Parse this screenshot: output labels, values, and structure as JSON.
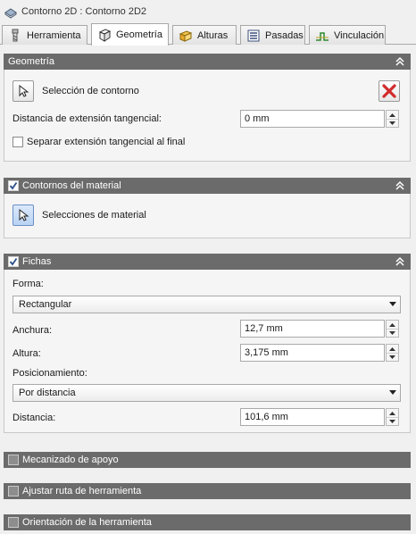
{
  "window": {
    "title": "Contorno 2D : Contorno 2D2"
  },
  "tabs": [
    {
      "label": "Herramienta",
      "icon": "tool-icon"
    },
    {
      "label": "Geometría",
      "icon": "cube-icon"
    },
    {
      "label": "Alturas",
      "icon": "heights-icon"
    },
    {
      "label": "Pasadas",
      "icon": "passes-icon"
    },
    {
      "label": "Vinculación",
      "icon": "linking-icon"
    }
  ],
  "active_tab": "Geometría",
  "geometria": {
    "title": "Geometría",
    "contour_button": "Selección de contorno",
    "tangential_label": "Distancia de extensión tangencial:",
    "tangential_value": "0 mm",
    "separate_label": "Separar extensión tangencial al final",
    "separate_checked": false
  },
  "material": {
    "title": "Contornos del material",
    "checked": true,
    "button": "Selecciones de material"
  },
  "fichas": {
    "title": "Fichas",
    "checked": true,
    "forma_label": "Forma:",
    "forma_value": "Rectangular",
    "anchura_label": "Anchura:",
    "anchura_value": "12,7 mm",
    "altura_label": "Altura:",
    "altura_value": "3,175 mm",
    "pos_label": "Posicionamiento:",
    "pos_value": "Por distancia",
    "distancia_label": "Distancia:",
    "distancia_value": "101,6 mm"
  },
  "collapsed_sections": [
    {
      "title": "Mecanizado de apoyo",
      "checked": false
    },
    {
      "title": "Ajustar ruta de herramienta",
      "checked": false
    },
    {
      "title": "Orientación de la herramienta",
      "checked": false
    }
  ],
  "colors": {
    "section_header": "#6b6b6b",
    "delete_red": "#d22b2b",
    "accent_blue": "#6b8fc6"
  }
}
